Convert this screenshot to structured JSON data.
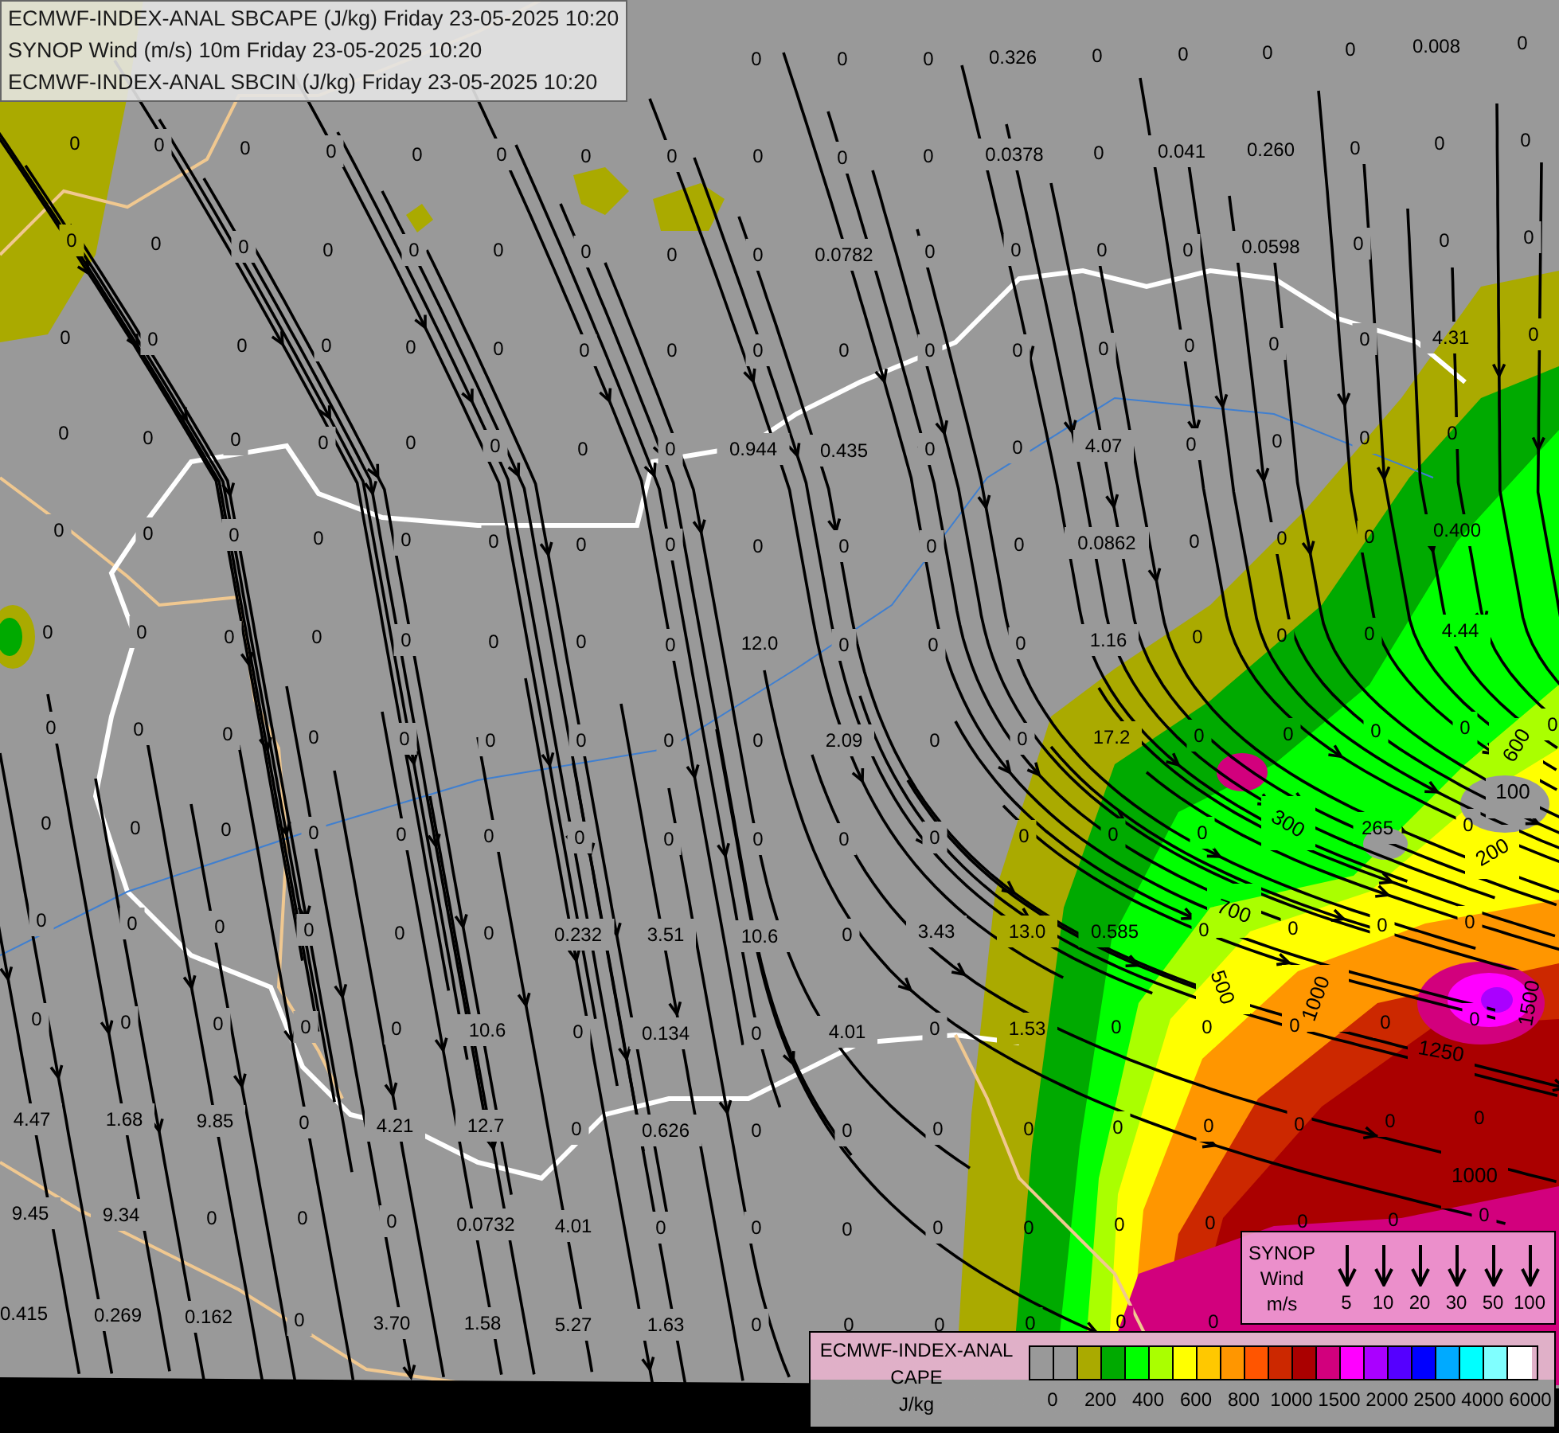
{
  "header": {
    "lines": [
      "ECMWF-INDEX-ANAL SBCAPE (J/kg) Friday 23-05-2025 10:20",
      "SYNOP Wind (m/s) 10m Friday 23-05-2025 10:20",
      "ECMWF-INDEX-ANAL SBCIN (J/kg) Friday 23-05-2025 10:20"
    ]
  },
  "map_values": [
    "0",
    "0",
    "0",
    "0.326",
    "0",
    "0",
    "0",
    "0",
    "0.008",
    "0",
    "0",
    "0",
    "0",
    "0",
    "0",
    "0",
    "0",
    "0",
    "0",
    "0",
    "0",
    "0.0378",
    "0",
    "0.041",
    "0.260",
    "0",
    "0",
    "0",
    "0",
    "0",
    "0",
    "0",
    "0",
    "0",
    "0",
    "0",
    "0",
    "0.0782",
    "0",
    "0",
    "0",
    "0",
    "0.0598",
    "0",
    "0",
    "0",
    "0",
    "0",
    "0",
    "0",
    "0",
    "0",
    "0",
    "0",
    "0",
    "0",
    "0",
    "0",
    "0",
    "0",
    "0",
    "0",
    "4.31",
    "0",
    "0",
    "0",
    "0",
    "0",
    "0",
    "0",
    "0",
    "0",
    "0.944",
    "0.435",
    "0",
    "0",
    "4.07",
    "0",
    "0",
    "0",
    "0",
    "0",
    "0",
    "0",
    "0",
    "0",
    "0",
    "0",
    "0",
    "0",
    "0",
    "0",
    "0",
    "0.0862",
    "0",
    "0",
    "0",
    "0.400",
    "0",
    "0",
    "0",
    "0",
    "0",
    "0",
    "0",
    "0",
    "12.0",
    "0",
    "0",
    "0",
    "1.16",
    "0",
    "0",
    "0",
    "4.44",
    "0",
    "0",
    "0",
    "0",
    "0",
    "0",
    "0",
    "0",
    "0",
    "2.09",
    "0",
    "0",
    "17.2",
    "0",
    "0",
    "0",
    "0",
    "0",
    "0",
    "0",
    "0",
    "0",
    "0",
    "0",
    "0",
    "0",
    "0",
    "0",
    "0",
    "0",
    "0",
    "0",
    "265",
    "0",
    "0",
    "0",
    "0",
    "0",
    "0",
    "0",
    "0.232",
    "3.51",
    "10.6",
    "0",
    "3.43",
    "13.0",
    "0.585",
    "0",
    "0",
    "0",
    "0",
    "0",
    "0",
    "0",
    "0",
    "0",
    "10.6",
    "0",
    "0.134",
    "0",
    "4.01",
    "0",
    "1.53",
    "0",
    "0",
    "0",
    "0",
    "0",
    "4.47",
    "1.68",
    "9.85",
    "0",
    "4.21",
    "12.7",
    "0",
    "0.626",
    "0",
    "0",
    "0",
    "0",
    "0",
    "0",
    "0",
    "0",
    "0",
    "9.45",
    "9.34",
    "0",
    "0",
    "0",
    "0.0732",
    "4.01",
    "0",
    "0",
    "0",
    "0",
    "0",
    "0",
    "0",
    "0",
    "0",
    "0",
    "0.415",
    "0.269",
    "0.162",
    "0",
    "3.70",
    "1.58",
    "5.27",
    "1.63",
    "0",
    "0",
    "0",
    "0",
    "0",
    "0"
  ],
  "contour_labels": [
    "300",
    "200",
    "100",
    "700",
    "500",
    "1000",
    "1250",
    "1500",
    "1000",
    "600"
  ],
  "wind_legend": {
    "title_lines": [
      "SYNOP",
      "Wind",
      "m/s"
    ],
    "speeds": [
      "5",
      "10",
      "20",
      "30",
      "50",
      "100"
    ]
  },
  "cape_legend": {
    "title_lines": [
      "ECMWF-INDEX-ANAL",
      "CAPE",
      "J/kg"
    ],
    "swatches": [
      {
        "color": "#999999"
      },
      {
        "color": "#999999"
      },
      {
        "color": "#aaaa00"
      },
      {
        "color": "#00aa00"
      },
      {
        "color": "#00ff00"
      },
      {
        "color": "#aaff00"
      },
      {
        "color": "#ffff00"
      },
      {
        "color": "#ffc800"
      },
      {
        "color": "#ff9600"
      },
      {
        "color": "#ff5500"
      },
      {
        "color": "#cc2800"
      },
      {
        "color": "#aa0000"
      },
      {
        "color": "#d2007d"
      },
      {
        "color": "#ff00ff"
      },
      {
        "color": "#aa00ff"
      },
      {
        "color": "#5500ff"
      },
      {
        "color": "#0000ff"
      },
      {
        "color": "#00aaff"
      },
      {
        "color": "#00ffff"
      },
      {
        "color": "#80ffff"
      },
      {
        "color": "#ffffff"
      }
    ],
    "ticks": [
      "0",
      "200",
      "400",
      "600",
      "800",
      "1000",
      "1500",
      "2000",
      "2500",
      "4000",
      "6000"
    ]
  }
}
